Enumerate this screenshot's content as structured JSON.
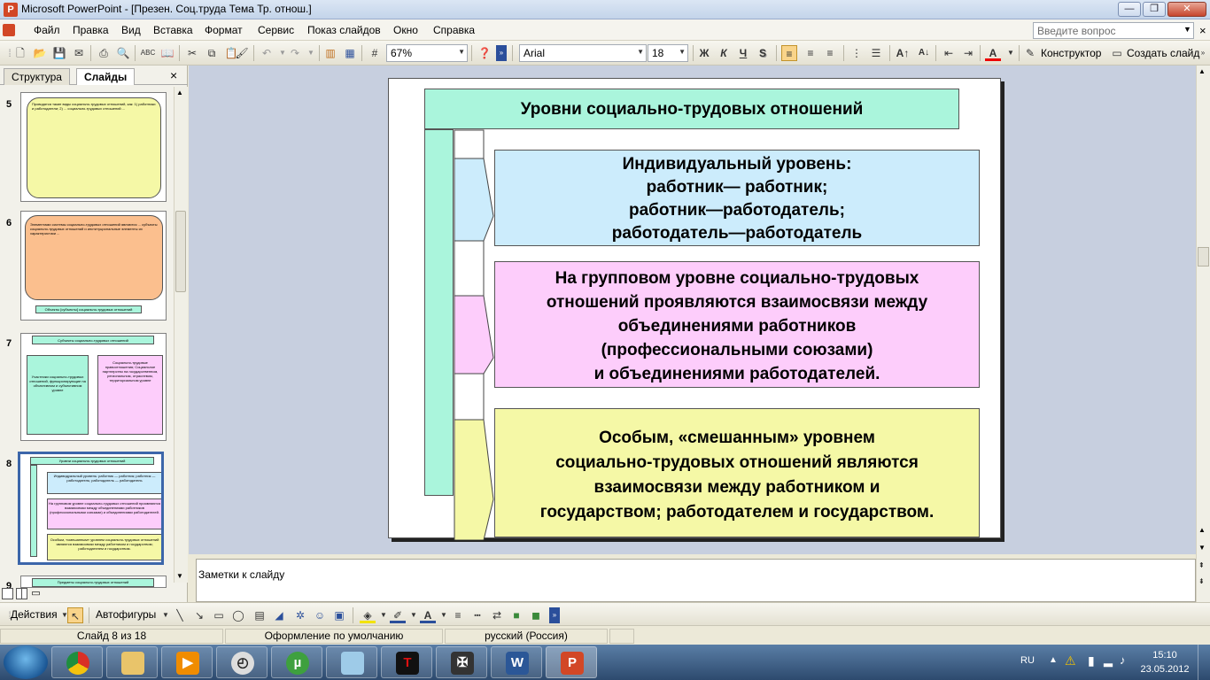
{
  "window": {
    "title": "Microsoft PowerPoint - [Презен. Соц.труда Тема Тр. отнош.]",
    "app_icon": "powerpoint-icon"
  },
  "menu": {
    "items": [
      "Файл",
      "Правка",
      "Вид",
      "Вставка",
      "Формат",
      "Сервис",
      "Показ слайдов",
      "Окно",
      "Справка"
    ],
    "help_placeholder": "Введите вопрос"
  },
  "toolbar": {
    "zoom": "67%",
    "font_name": "Arial",
    "font_size": "18",
    "bold": "Ж",
    "italic": "К",
    "underline": "Ч",
    "shadow": "S",
    "designer": "Конструктор",
    "new_slide": "Создать слайд"
  },
  "left_panel": {
    "tab_outline": "Структура",
    "tab_slides": "Слайды",
    "close": "×",
    "thumbs": [
      {
        "num": "5",
        "text": "Проводятся такие виды социально-трудовых отношений, как: 1) работники и работодатели; 2) ... социально-трудовых отношений ..."
      },
      {
        "num": "6",
        "text": "Элементами системы социально-трудовых отношений являются ... субъекты социально-трудовых отношений и институциональные элементы их характеристики ...",
        "caption": "Объекты [субъекты] социально-трудовых отношений"
      },
      {
        "num": "7",
        "title": "Субъекты социально-трудовых отношений",
        "left": "Участники социально-трудовых отношений, функционирующие на объективном и субъективном уровне",
        "right": "Социально-трудовые правоотношения; Социальное партнерство на государственном, региональном, отраслевом, территориальном уровне"
      },
      {
        "num": "8",
        "title": "Уровни социально-трудовых отношений",
        "b1": "Индивидуальный уровень: работник — работник; работник — работодатель; работодатель — работодатель",
        "b2": "На групповом уровне социально-трудовых отношений проявляются взаимосвязи между объединениями работников (профессиональными союзами) и объединениями работодателей.",
        "b3": "Особым, «смешанным» уровнем социально-трудовых отношений являются взаимосвязи между работником и государством; работодателем и государством."
      },
      {
        "num": "9",
        "title": "Предметы социально-трудовых отношений"
      }
    ]
  },
  "slide": {
    "title": "Уровни социально-трудовых отношений",
    "block1_lines": [
      "Индивидуальный уровень:",
      "работник— работник;",
      "работник—работодатель;",
      "работодатель—работодатель"
    ],
    "block2_lines": [
      "На групповом уровне социально-трудовых",
      "отношений проявляются взаимосвязи между",
      "объединениями работников",
      "(профессиональными союзами)",
      "и объединениями работодателей."
    ],
    "block3_lines": [
      "Особым, «смешанным» уровнем",
      "социально-трудовых отношений являются",
      "взаимосвязи между работником и",
      "государством; работодателем и государством."
    ],
    "colors": {
      "title_bg": "#aaf5dc",
      "block1_bg": "#ccecfc",
      "block2_bg": "#fdcdfb",
      "block3_bg": "#f5f8a6",
      "spine_bg": "#aaf5dc"
    }
  },
  "notes": {
    "text": "Заметки к слайду"
  },
  "drawing_toolbar": {
    "actions": "Действия",
    "autoshapes": "Автофигуры"
  },
  "status": {
    "slide": "Слайд 8 из 18",
    "design": "Оформление по умолчанию",
    "language": "русский (Россия)"
  },
  "taskbar": {
    "apps": [
      "chrome-icon",
      "folder-icon",
      "media-player-icon",
      "clock-icon",
      "utorrent-icon",
      "notepad-icon",
      "tesla-icon",
      "game-icon",
      "word-icon",
      "powerpoint-icon"
    ],
    "lang": "RU",
    "time": "15:10",
    "date": "23.05.2012"
  }
}
